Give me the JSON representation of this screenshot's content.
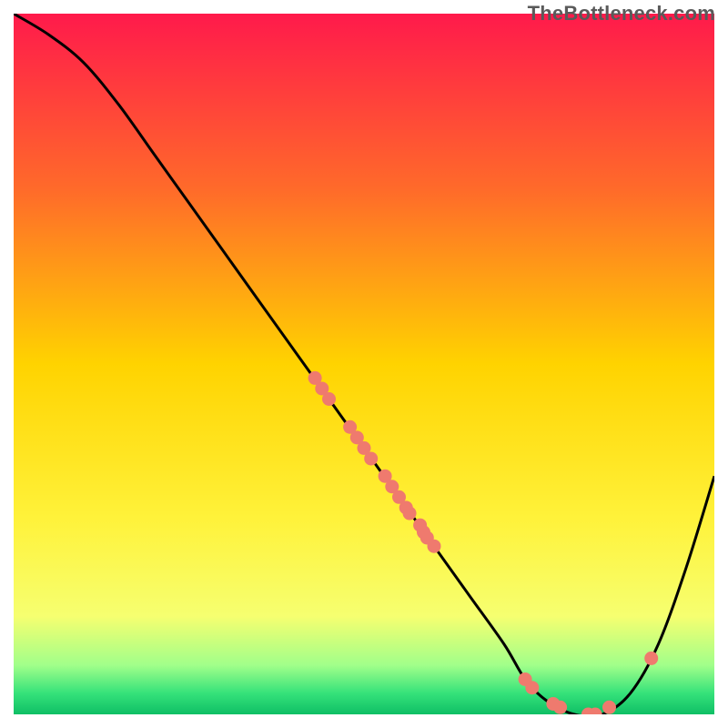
{
  "watermark": "TheBottleneck.com",
  "chart_data": {
    "type": "line",
    "title": "",
    "xlabel": "",
    "ylabel": "",
    "xlim": [
      0,
      100
    ],
    "ylim": [
      0,
      100
    ],
    "grid": false,
    "legend": false,
    "annotations": [],
    "background_gradient": {
      "stops": [
        {
          "offset": 0.0,
          "color": "#ff1a4b"
        },
        {
          "offset": 0.25,
          "color": "#ff6a2a"
        },
        {
          "offset": 0.5,
          "color": "#ffd300"
        },
        {
          "offset": 0.72,
          "color": "#fff23a"
        },
        {
          "offset": 0.86,
          "color": "#f6ff70"
        },
        {
          "offset": 0.93,
          "color": "#a1ff8a"
        },
        {
          "offset": 0.97,
          "color": "#35e27a"
        },
        {
          "offset": 1.0,
          "color": "#0fbf65"
        }
      ]
    },
    "series": [
      {
        "name": "bottleneck-curve",
        "color": "#000000",
        "x": [
          0,
          5,
          10,
          15,
          20,
          25,
          30,
          35,
          40,
          45,
          50,
          55,
          60,
          65,
          70,
          73,
          76,
          80,
          84,
          88,
          92,
          96,
          100
        ],
        "y": [
          100,
          97,
          93,
          87,
          80,
          73,
          66,
          59,
          52,
          45,
          38,
          31,
          24,
          17,
          10,
          5,
          2,
          0,
          0,
          3,
          10,
          21,
          34
        ]
      }
    ],
    "scatter": [
      {
        "name": "curve-markers",
        "color": "#ef7a6e",
        "points": [
          {
            "x": 43,
            "y": 48
          },
          {
            "x": 44,
            "y": 46.5
          },
          {
            "x": 45,
            "y": 45
          },
          {
            "x": 48,
            "y": 41
          },
          {
            "x": 49,
            "y": 39.5
          },
          {
            "x": 50,
            "y": 38
          },
          {
            "x": 51,
            "y": 36.5
          },
          {
            "x": 53,
            "y": 34
          },
          {
            "x": 54,
            "y": 32.5
          },
          {
            "x": 55,
            "y": 31
          },
          {
            "x": 56,
            "y": 29.5
          },
          {
            "x": 56.5,
            "y": 28.7
          },
          {
            "x": 58,
            "y": 27
          },
          {
            "x": 58.5,
            "y": 26
          },
          {
            "x": 59,
            "y": 25.2
          },
          {
            "x": 60,
            "y": 24
          },
          {
            "x": 73,
            "y": 5
          },
          {
            "x": 74,
            "y": 3.8
          },
          {
            "x": 77,
            "y": 1.5
          },
          {
            "x": 78,
            "y": 1
          },
          {
            "x": 82,
            "y": 0
          },
          {
            "x": 83,
            "y": 0
          },
          {
            "x": 85,
            "y": 1
          },
          {
            "x": 91,
            "y": 8
          }
        ]
      }
    ]
  }
}
